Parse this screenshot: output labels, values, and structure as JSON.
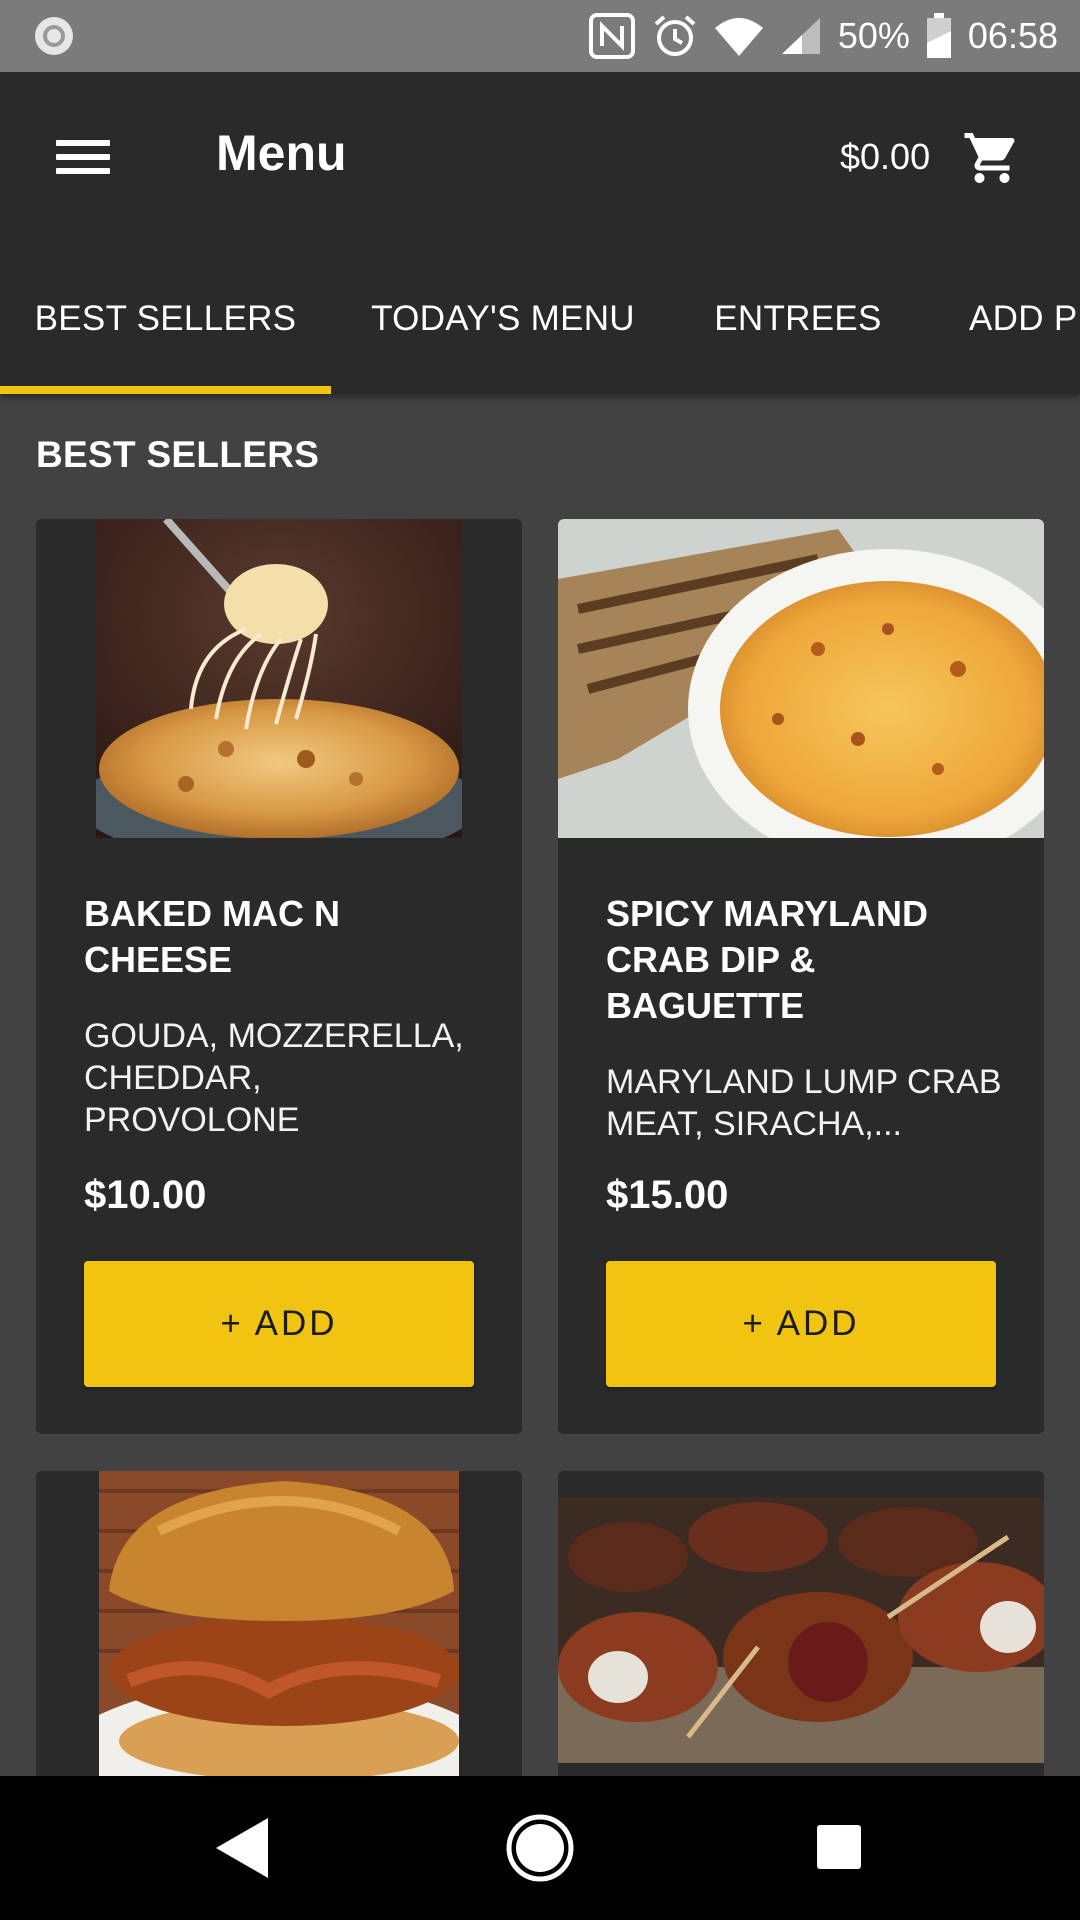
{
  "status_bar": {
    "battery": "50%",
    "time": "06:58"
  },
  "app_bar": {
    "title": "Menu",
    "cart_total": "$0.00"
  },
  "tabs": [
    {
      "label": "BEST SELLERS",
      "selected": true
    },
    {
      "label": "TODAY'S MENU",
      "selected": false
    },
    {
      "label": "ENTREES",
      "selected": false
    },
    {
      "label": "ADD PR",
      "selected": false
    }
  ],
  "section": {
    "title": "BEST SELLERS"
  },
  "items": [
    {
      "name": "BAKED MAC N CHEESE",
      "description": "GOUDA, MOZZERELLA, CHEDDAR, PROVOLONE",
      "price": "$10.00",
      "add_label": "+ ADD"
    },
    {
      "name": "SPICY MARYLAND CRAB DIP & BAGUETTE",
      "description": "MARYLAND LUMP CRAB MEAT, SIRACHA,...",
      "price": "$15.00",
      "add_label": "+ ADD"
    }
  ],
  "colors": {
    "accent": "#f0c410",
    "app_bar": "#2a2a2a",
    "background": "#424242",
    "card": "#2a2a2a"
  },
  "icons": {
    "menu": "hamburger-menu-icon",
    "cart": "shopping-cart-icon",
    "back": "back-triangle-icon",
    "home": "home-circle-icon",
    "recents": "recents-square-icon"
  }
}
